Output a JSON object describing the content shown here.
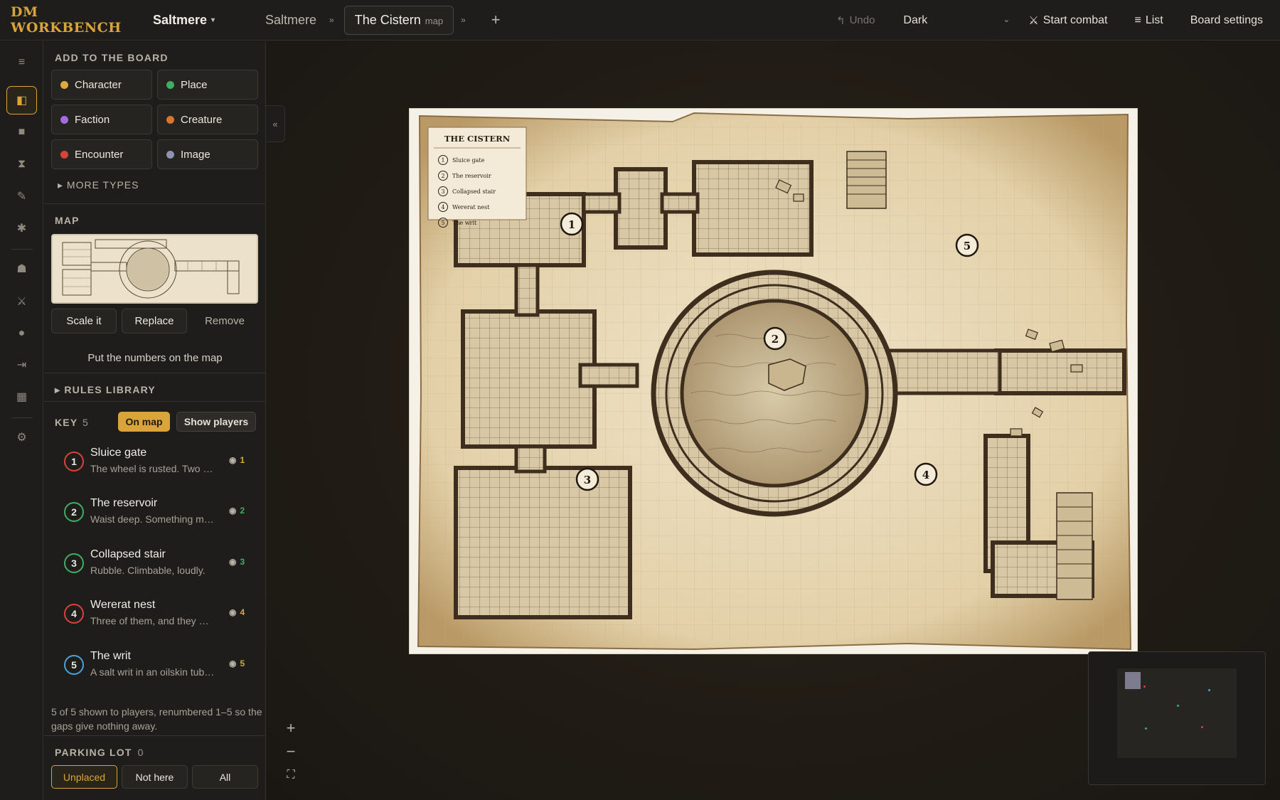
{
  "topbar": {
    "brand": "DM WORKBENCH",
    "campaign": "Saltmere",
    "breadcrumb": "Saltmere",
    "active_tab": "The Cistern",
    "active_tab_kind": "map",
    "undo": "Undo",
    "theme": "Dark",
    "start_combat": "Start combat",
    "list": "List",
    "board_settings": "Board settings"
  },
  "panel": {
    "add_title": "ADD TO THE BOARD",
    "add_types": [
      {
        "label": "Character",
        "color": "#e0a83a"
      },
      {
        "label": "Place",
        "color": "#3fae63"
      },
      {
        "label": "Faction",
        "color": "#a46be0"
      },
      {
        "label": "Creature",
        "color": "#d9752e"
      },
      {
        "label": "Encounter",
        "color": "#d9413a"
      },
      {
        "label": "Image",
        "color": "#8e93b3"
      }
    ],
    "more_types": "MORE TYPES",
    "map_title": "MAP",
    "map_buttons": {
      "scale": "Scale it",
      "replace": "Replace",
      "remove": "Remove"
    },
    "put_numbers": "Put the numbers on the map",
    "rules_library": "RULES LIBRARY",
    "key_title": "KEY",
    "key_count": "5",
    "on_map": "On map",
    "show_players": "Show players",
    "key_items": [
      {
        "num": "1",
        "name": "Sluice gate",
        "desc": "The wheel is rusted. Two …",
        "color": "#d9413a",
        "vis": "1",
        "vis_color": "#d9a53a"
      },
      {
        "num": "2",
        "name": "The reservoir",
        "desc": "Waist deep. Something m…",
        "color": "#3fae63",
        "vis": "2",
        "vis_color": "#3fae63"
      },
      {
        "num": "3",
        "name": "Collapsed stair",
        "desc": "Rubble. Climbable, loudly.",
        "color": "#3fae63",
        "vis": "3",
        "vis_color": "#3fae63"
      },
      {
        "num": "4",
        "name": "Wererat nest",
        "desc": "Three of them, and they …",
        "color": "#d9413a",
        "vis": "4",
        "vis_color": "#d9a53a"
      },
      {
        "num": "5",
        "name": "The writ",
        "desc": "A salt writ in an oilskin tub…",
        "color": "#4aa3d9",
        "vis": "5",
        "vis_color": "#d9a53a"
      }
    ],
    "key_footnote": "5 of 5 shown to players, renumbered 1–5 so the gaps give nothing away.",
    "parking_title": "PARKING LOT",
    "parking_count": "0",
    "parking_filters": {
      "unplaced": "Unplaced",
      "not_here": "Not here",
      "all": "All"
    }
  },
  "map": {
    "legend_title": "THE CISTERN",
    "legend": [
      {
        "num": "1",
        "label": "Sluice gate"
      },
      {
        "num": "2",
        "label": "The reservoir"
      },
      {
        "num": "3",
        "label": "Collapsed stair"
      },
      {
        "num": "4",
        "label": "Wererat nest"
      },
      {
        "num": "5",
        "label": "The writ"
      }
    ],
    "markers": [
      "1",
      "2",
      "3",
      "4",
      "5"
    ]
  },
  "icons": {
    "menu": "hamburger-icon",
    "zoom_in": "plus-icon",
    "zoom_out": "minus-icon",
    "fit": "fullscreen-icon"
  }
}
